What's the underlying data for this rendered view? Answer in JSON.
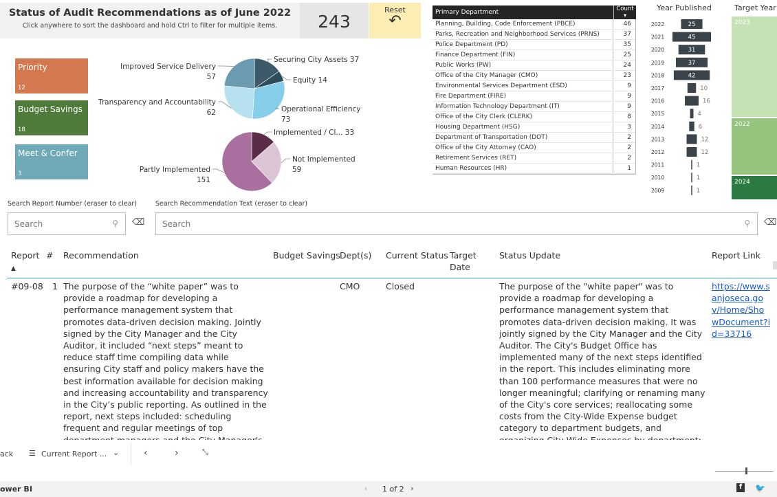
{
  "header": {
    "title": "Status of Audit Recommendations as of June 2022",
    "subtitle": "Click anywhere to sort the dashboard and hold Ctrl to filter for multiple items."
  },
  "total_count": "243",
  "reset": {
    "label": "Reset",
    "icon": "undo-arrow-icon"
  },
  "tiles": [
    {
      "label": "Priority",
      "count": "12",
      "color": "#d4784f"
    },
    {
      "label": "Budget Savings",
      "count": "18",
      "color": "#4f7c3a"
    },
    {
      "label": "Meet & Confer",
      "count": "3",
      "color": "#6fa8b7"
    }
  ],
  "chart_data": [
    {
      "type": "pie",
      "title": "",
      "categories": [
        "Securing City Assets",
        "Equity",
        "Operational Efficiency",
        "Transparency and Accountability",
        "Improved Service Delivery"
      ],
      "values": [
        37,
        14,
        73,
        62,
        57
      ],
      "labels": [
        "Securing City Assets 37",
        "Equity 14",
        "Operational Efficiency",
        "Transparency and Accountability",
        "Improved Service Delivery"
      ],
      "value_labels": [
        "",
        "",
        "73",
        "62",
        "57"
      ],
      "colors": [
        "#3c5a6a",
        "#2e4c5a",
        "#87ceea",
        "#b8e1ef",
        "#6a9bb0"
      ]
    },
    {
      "type": "pie",
      "title": "",
      "categories": [
        "Implemented / Cl...",
        "Not Implemented",
        "Partly Implemented"
      ],
      "values": [
        33,
        59,
        151
      ],
      "labels": [
        "Implemented / Cl... 33",
        "Not Implemented",
        "Partly Implemented"
      ],
      "value_labels": [
        "",
        "59",
        "151"
      ],
      "colors": [
        "#5a2c48",
        "#dcc3d6",
        "#a96f9f"
      ]
    },
    {
      "type": "bar",
      "title": "Year Published",
      "categories": [
        "2022",
        "2021",
        "2020",
        "2019",
        "2018",
        "2017",
        "2016",
        "2015",
        "2014",
        "2013",
        "2012",
        "2011",
        "2010",
        "2009"
      ],
      "values": [
        25,
        45,
        31,
        37,
        42,
        10,
        16,
        4,
        6,
        12,
        12,
        1,
        1,
        1
      ],
      "color": "#3b444a"
    }
  ],
  "departments": {
    "header_label": "Primary Department",
    "header_count": "Count",
    "rows": [
      {
        "name": "Planning, Building, Code Enforcement (PBCE)",
        "count": "46"
      },
      {
        "name": "Parks, Recreation and Neighborhood Services (PRNS)",
        "count": "37"
      },
      {
        "name": "Police Department (PD)",
        "count": "35"
      },
      {
        "name": "Finance Department (FIN)",
        "count": "25"
      },
      {
        "name": "Public Works (PW)",
        "count": "24"
      },
      {
        "name": "Office of the City Manager (CMO)",
        "count": "23"
      },
      {
        "name": "Environmental Services Department (ESD)",
        "count": "9"
      },
      {
        "name": "Fire Department (FIRE)",
        "count": "9"
      },
      {
        "name": "Information Technology Department (IT)",
        "count": "9"
      },
      {
        "name": "Office of the City Clerk (CLERK)",
        "count": "8"
      },
      {
        "name": "Housing Department (HSG)",
        "count": "3"
      },
      {
        "name": "Department of Transportation (DOT)",
        "count": "2"
      },
      {
        "name": "Office of the City Attorney (CAO)",
        "count": "2"
      },
      {
        "name": "Retirement Services (RET)",
        "count": "2"
      },
      {
        "name": "Human Resources (HR)",
        "count": "1"
      }
    ]
  },
  "year_published_title": "Year Published",
  "target_year": {
    "title": "Target Year",
    "bars": [
      {
        "label": "2023",
        "color": "#c5e2b5"
      },
      {
        "label": "2022",
        "color": "#94c47d"
      },
      {
        "label": "2024",
        "color": "#2c7a43"
      }
    ]
  },
  "search": {
    "report_label": "Search Report Number (eraser to clear)",
    "report_placeholder": "Search",
    "text_label": "Search Recommendation Text (eraser to clear)",
    "text_placeholder": "Search"
  },
  "table": {
    "columns": [
      "Report",
      "#",
      "Recommendation",
      "Budget Savings",
      "Dept(s)",
      "Current Status",
      "Target Date",
      "Status Update",
      "Report Link"
    ],
    "rows": [
      {
        "report": "#09-08",
        "num": "1",
        "recommendation": "The purpose of the “white paper” was to provide a roadmap for developing a performance management system that promotes data-driven decision making. Jointly signed by the City Manager and the City Auditor, it included “next steps” meant to reduce staff time compiling data while ensuring City staff and policy makers have the best information available for decision making and increasing accountability and transparency in the City’s public reporting. As outlined in the report, next steps included: scheduling frequent and regular meetings of top department managers and the City Manager's Office to proactively discuss",
        "budget_savings": "",
        "dept": "CMO",
        "status": "Closed",
        "target_date": "",
        "status_update": "The purpose of the \"white paper\" was to provide a roadmap for developing a performance management system that promotes data-driven decision making. It was jointly signed by the City Manager and the City Auditor. The City's Budget Office has implemented many of the next steps identified in the report. This includes eliminating more than 100 performance measures that were no longer meaningful; clarifying or renaming many of the City's core services; reallocating some costs from the City-Wide Expense budget category to department budgets, and organizing City-Wide Expenses by department; requiring up-to-date",
        "link": "https://www.sanjoseca.gov/Home/ShowDocument?id=33716"
      }
    ]
  },
  "bottom_bar": {
    "back_label": "ack",
    "page_menu_label": "Current Report ...",
    "pager": "1 of 2",
    "app_name": "ower BI"
  }
}
